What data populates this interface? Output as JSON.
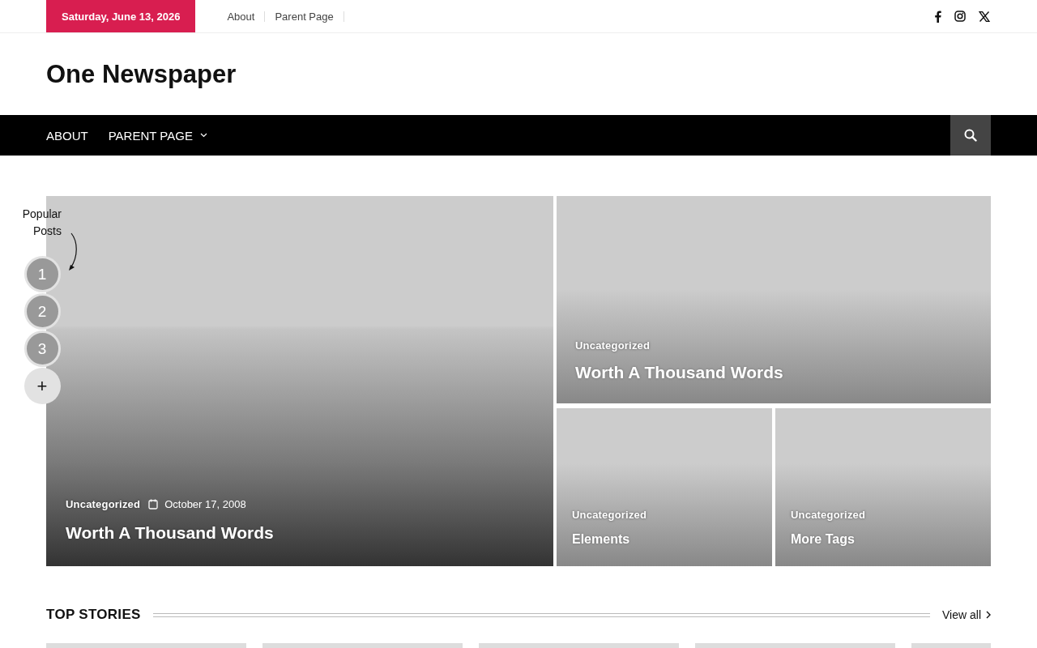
{
  "top_bar": {
    "date": "Saturday, June 13, 2026",
    "links": [
      "About",
      "Parent Page"
    ]
  },
  "site_title": "One Newspaper",
  "nav": {
    "items": [
      {
        "label": "ABOUT",
        "dropdown": false
      },
      {
        "label": "PARENT PAGE",
        "dropdown": true
      }
    ]
  },
  "popular_posts": {
    "label_line_1": "Popular",
    "label_line_2": "Posts",
    "numbers": [
      "1",
      "2",
      "3"
    ],
    "more": "+"
  },
  "featured": [
    {
      "kind": "main",
      "category": "Uncategorized",
      "date": "October 17, 2008",
      "title": "Worth A Thousand Words"
    },
    {
      "kind": "wide",
      "category": "Uncategorized",
      "title": "Worth A Thousand Words"
    },
    {
      "kind": "small",
      "category": "Uncategorized",
      "title": "Elements"
    },
    {
      "kind": "small",
      "category": "Uncategorized",
      "title": "More Tags"
    }
  ],
  "top_stories": {
    "title": "TOP STORIES",
    "view_all": "View all",
    "cards": [
      {
        "kind": "placeholder"
      },
      {
        "kind": "placeholder"
      },
      {
        "kind": "placeholder"
      },
      {
        "kind": "placeholder"
      },
      {
        "kind": "placeholder"
      }
    ]
  }
}
